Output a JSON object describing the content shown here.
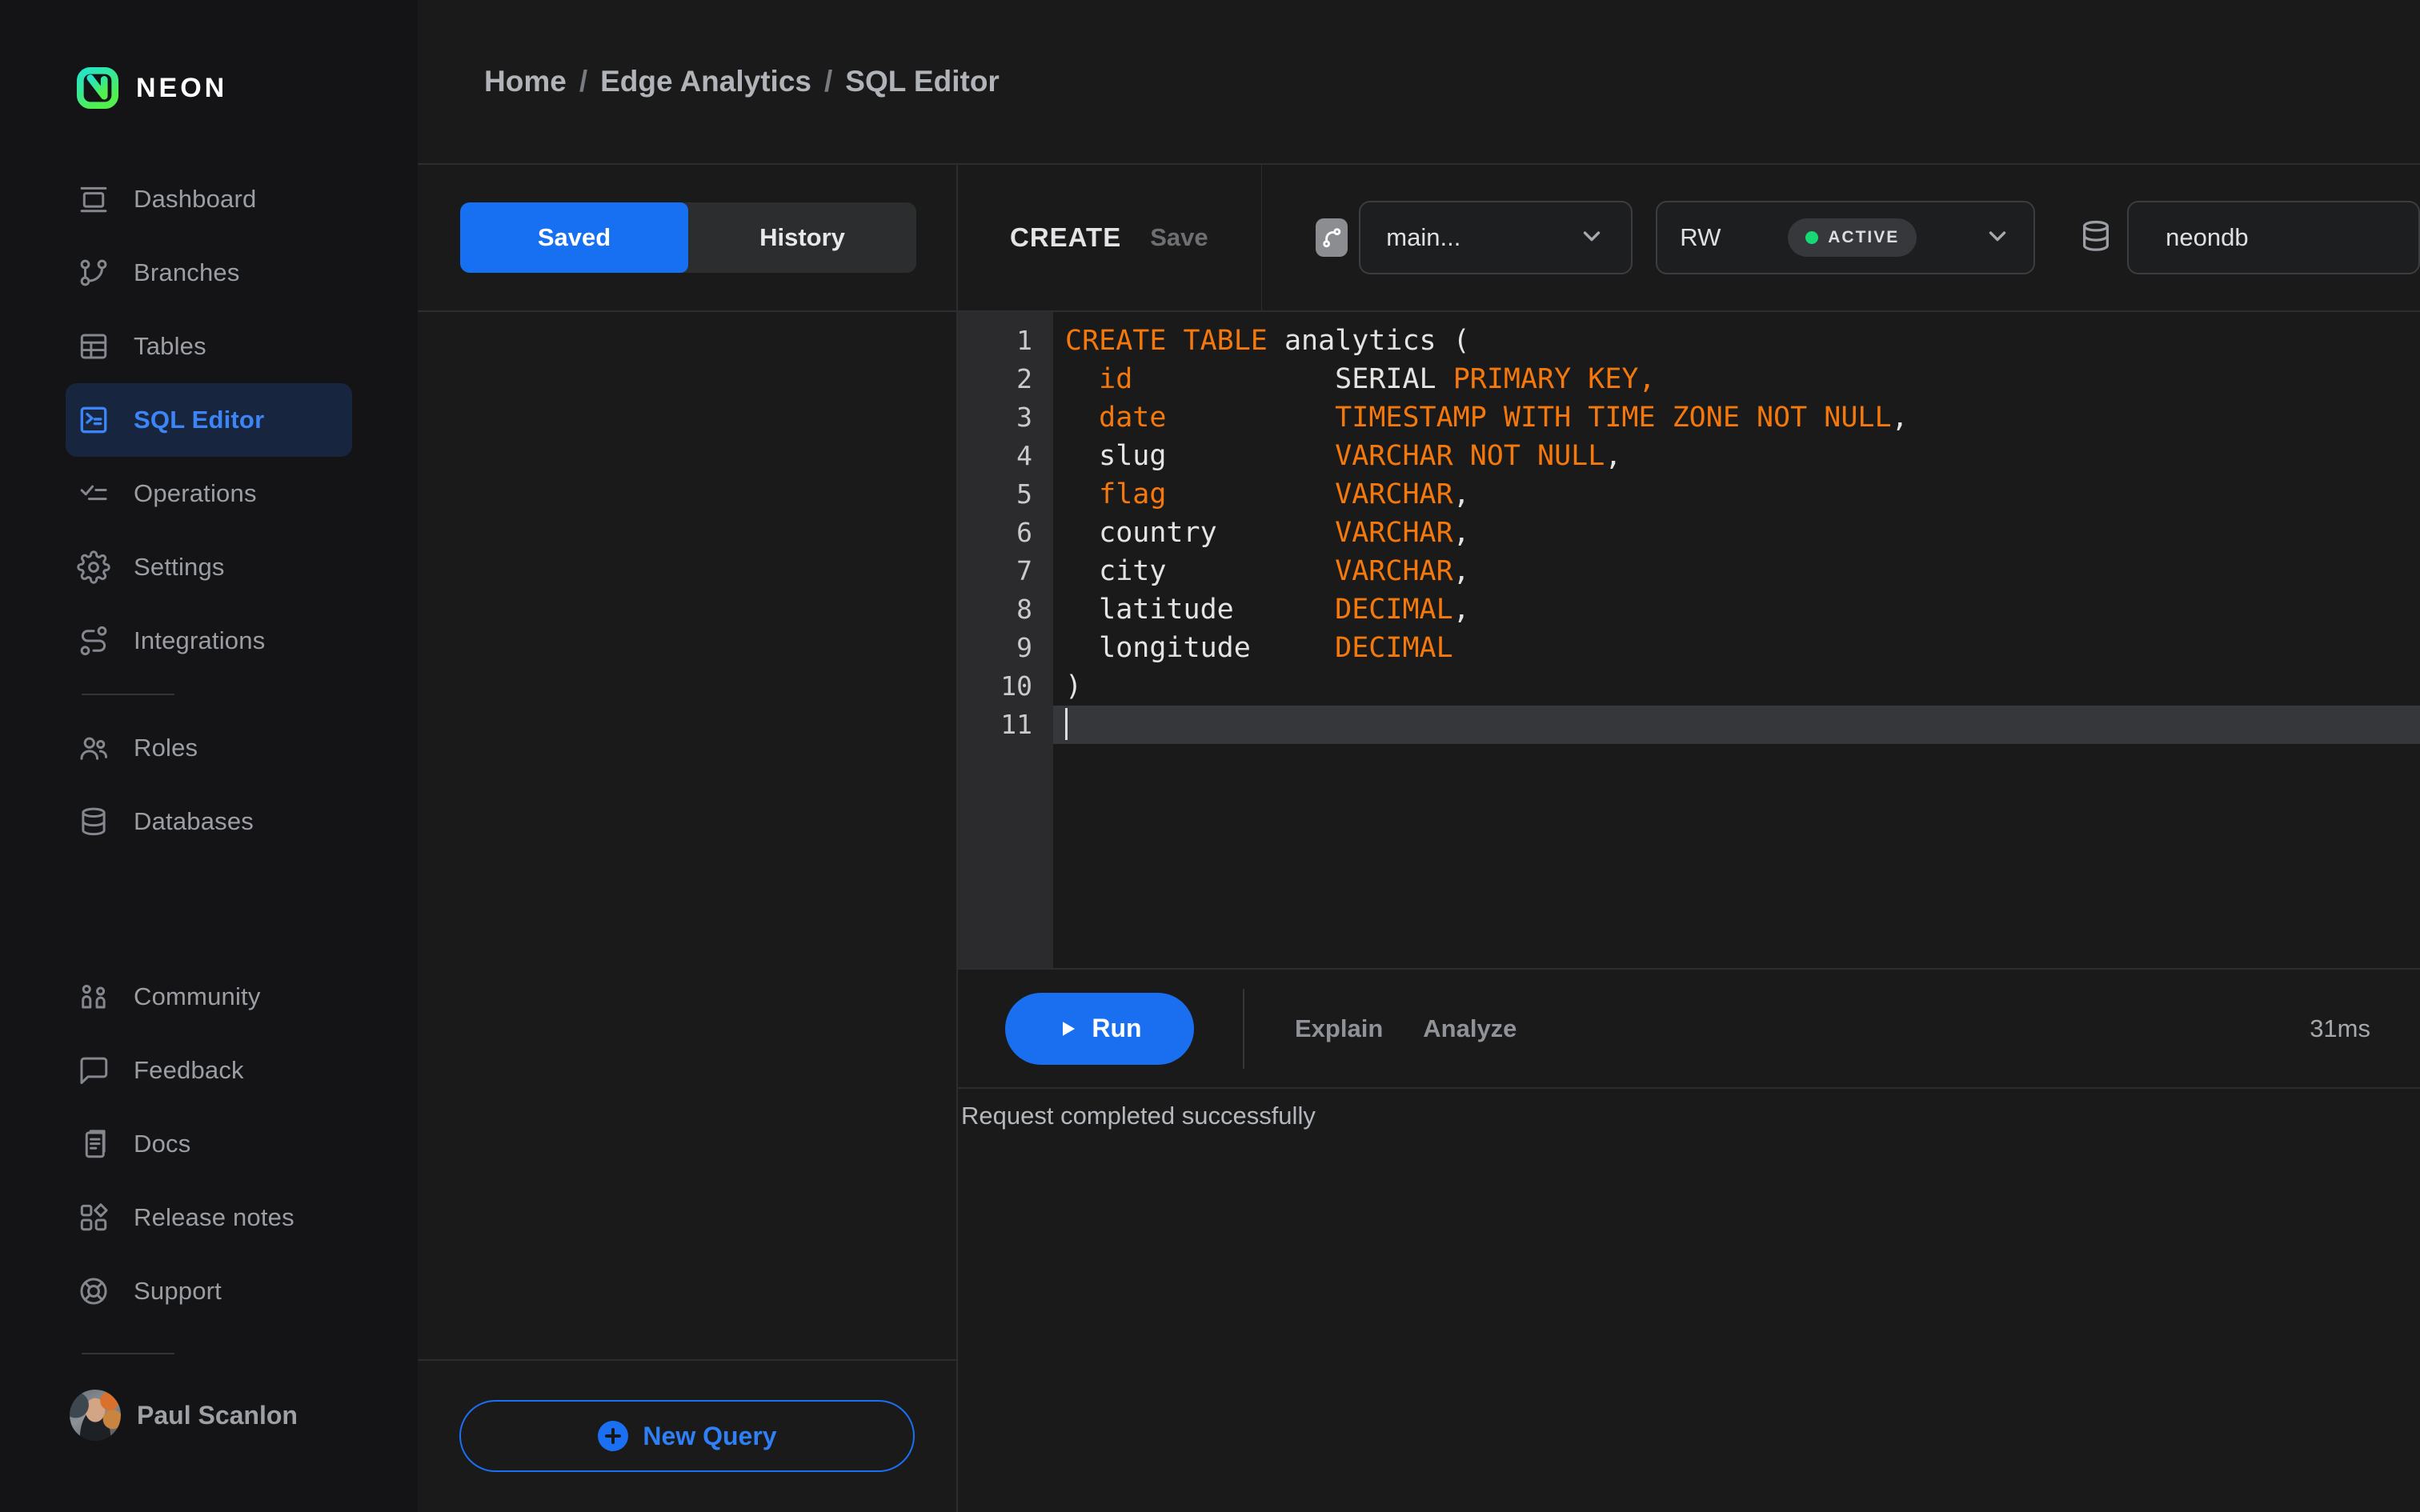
{
  "colors": {
    "accent_blue": "#1a6ff3",
    "code_orange": "#f4780c",
    "code_plain": "#e4e4e2",
    "status_green": "#16d974",
    "active_nav_bg": "#17263e"
  },
  "sidebar": {
    "logo_text": "NEON",
    "nav_main": [
      {
        "label": "Dashboard",
        "icon": "dashboard-icon",
        "active": false
      },
      {
        "label": "Branches",
        "icon": "branches-icon",
        "active": false
      },
      {
        "label": "Tables",
        "icon": "tables-icon",
        "active": false
      },
      {
        "label": "SQL Editor",
        "icon": "sql-editor-icon",
        "active": true
      },
      {
        "label": "Operations",
        "icon": "operations-icon",
        "active": false
      },
      {
        "label": "Settings",
        "icon": "settings-icon",
        "active": false
      },
      {
        "label": "Integrations",
        "icon": "integrations-icon",
        "active": false
      }
    ],
    "nav_data": [
      {
        "label": "Roles",
        "icon": "roles-icon",
        "active": false
      },
      {
        "label": "Databases",
        "icon": "databases-icon",
        "active": false
      }
    ],
    "nav_footer": [
      {
        "label": "Community",
        "icon": "community-icon",
        "active": false
      },
      {
        "label": "Feedback",
        "icon": "feedback-icon",
        "active": false
      },
      {
        "label": "Docs",
        "icon": "docs-icon",
        "active": false
      },
      {
        "label": "Release notes",
        "icon": "release-notes-icon",
        "active": false
      },
      {
        "label": "Support",
        "icon": "support-icon",
        "active": false
      }
    ],
    "user": {
      "name": "Paul Scanlon"
    }
  },
  "breadcrumb": {
    "items": [
      "Home",
      "Edge Analytics",
      "SQL Editor"
    ],
    "separator": "/"
  },
  "left_panel": {
    "tabs": [
      {
        "label": "Saved",
        "active": true
      },
      {
        "label": "History",
        "active": false
      }
    ],
    "new_query_label": "New Query"
  },
  "editor": {
    "title": "CREATE",
    "save_label": "Save",
    "branch_select": {
      "value": "main..."
    },
    "endpoint_select": {
      "value": "RW",
      "status": "ACTIVE"
    },
    "database_select": {
      "value": "neondb"
    },
    "code_lines": [
      {
        "n": 1,
        "tokens": [
          {
            "c": "o",
            "t": "CREATE TABLE"
          },
          {
            "c": "p",
            "t": " analytics ("
          }
        ]
      },
      {
        "n": 2,
        "tokens": [
          {
            "c": "p",
            "t": "  "
          },
          {
            "c": "o",
            "t": "id"
          },
          {
            "c": "p",
            "t": "            SERIAL "
          },
          {
            "c": "o",
            "t": "PRIMARY KEY,"
          }
        ]
      },
      {
        "n": 3,
        "tokens": [
          {
            "c": "p",
            "t": "  "
          },
          {
            "c": "o",
            "t": "date"
          },
          {
            "c": "p",
            "t": "          "
          },
          {
            "c": "o",
            "t": "TIMESTAMP WITH TIME ZONE NOT NULL"
          },
          {
            "c": "p",
            "t": ","
          }
        ]
      },
      {
        "n": 4,
        "tokens": [
          {
            "c": "p",
            "t": "  slug          "
          },
          {
            "c": "o",
            "t": "VARCHAR NOT NULL"
          },
          {
            "c": "p",
            "t": ","
          }
        ]
      },
      {
        "n": 5,
        "tokens": [
          {
            "c": "p",
            "t": "  "
          },
          {
            "c": "o",
            "t": "flag"
          },
          {
            "c": "p",
            "t": "          "
          },
          {
            "c": "o",
            "t": "VARCHAR"
          },
          {
            "c": "p",
            "t": ","
          }
        ]
      },
      {
        "n": 6,
        "tokens": [
          {
            "c": "p",
            "t": "  country       "
          },
          {
            "c": "o",
            "t": "VARCHAR"
          },
          {
            "c": "p",
            "t": ","
          }
        ]
      },
      {
        "n": 7,
        "tokens": [
          {
            "c": "p",
            "t": "  city          "
          },
          {
            "c": "o",
            "t": "VARCHAR"
          },
          {
            "c": "p",
            "t": ","
          }
        ]
      },
      {
        "n": 8,
        "tokens": [
          {
            "c": "p",
            "t": "  latitude      "
          },
          {
            "c": "o",
            "t": "DECIMAL"
          },
          {
            "c": "p",
            "t": ","
          }
        ]
      },
      {
        "n": 9,
        "tokens": [
          {
            "c": "p",
            "t": "  longitude     "
          },
          {
            "c": "o",
            "t": "DECIMAL"
          }
        ]
      },
      {
        "n": 10,
        "tokens": [
          {
            "c": "p",
            "t": ")"
          }
        ]
      },
      {
        "n": 11,
        "tokens": [],
        "cursor": true,
        "active": true
      }
    ],
    "run_label": "Run",
    "explain_label": "Explain",
    "analyze_label": "Analyze",
    "duration": "31ms",
    "status_message": "Request completed successfully"
  }
}
